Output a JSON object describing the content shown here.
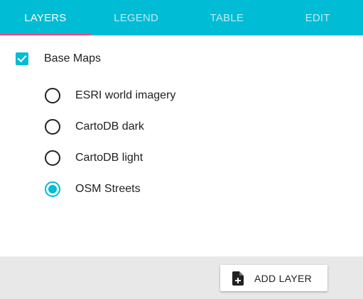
{
  "colors": {
    "accent": "#00bcd4",
    "tab_indicator": "#ff4081",
    "footer_bg": "#e8e8e8"
  },
  "tabs": [
    {
      "label": "LAYERS",
      "active": true
    },
    {
      "label": "LEGEND",
      "active": false
    },
    {
      "label": "TABLE",
      "active": false
    },
    {
      "label": "EDIT",
      "active": false
    }
  ],
  "layers": {
    "group": {
      "label": "Base Maps",
      "checked": true
    },
    "options": [
      {
        "label": "ESRI world imagery",
        "selected": false
      },
      {
        "label": "CartoDB dark",
        "selected": false
      },
      {
        "label": "CartoDB light",
        "selected": false
      },
      {
        "label": "OSM Streets",
        "selected": true
      }
    ]
  },
  "footer": {
    "add_layer_label": "ADD LAYER",
    "add_layer_icon": "note-add-icon"
  }
}
